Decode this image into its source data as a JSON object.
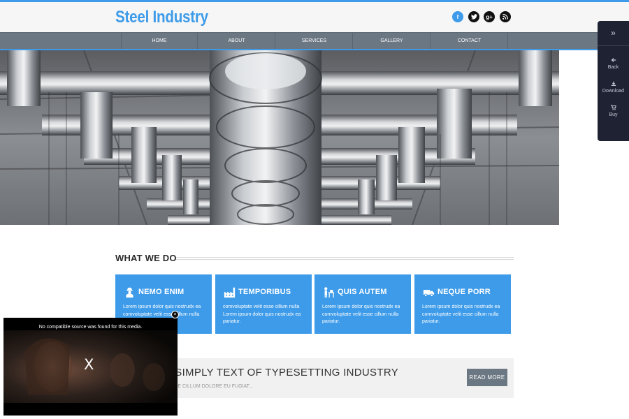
{
  "header": {
    "logo": "Steel Industry",
    "social": [
      {
        "icon": "facebook-icon",
        "glyph": "f",
        "color": "#3d9be9"
      },
      {
        "icon": "twitter-icon",
        "glyph": "",
        "color": "#111111"
      },
      {
        "icon": "google-plus-icon",
        "glyph": "g+",
        "color": "#111111"
      },
      {
        "icon": "rss-icon",
        "glyph": "",
        "color": "#111111"
      }
    ]
  },
  "nav": {
    "items": [
      "HOME",
      "ABOUT",
      "SERVICES",
      "GALLERY",
      "CONTACT"
    ]
  },
  "side_panel": {
    "expand_icon": "double-chevron-right-icon",
    "buttons": [
      {
        "icon": "arrow-left-icon",
        "label": "Back"
      },
      {
        "icon": "download-icon",
        "label": "Download"
      },
      {
        "icon": "cart-icon",
        "label": "Buy"
      }
    ]
  },
  "what_we_do": {
    "title": "WHAT WE DO",
    "cards": [
      {
        "icon": "worker-icon",
        "title": "NEMO ENIM",
        "text": "Lorem ipsum dolor quis nostrudx ea comvoluptate velit esse cillum nulla pariatur."
      },
      {
        "icon": "factory-icon",
        "title": "TEMPORIBUS",
        "text": "comvoluptate velit esse cillum nulla Lorem ipsum dolor quis nostrudx ea pariatur."
      },
      {
        "icon": "engineer-desk-icon",
        "title": "QUIS AUTEM",
        "text": "Lorem ipsum dolor quis nostrudx ea comvoluptate velit esse cillum nulla pariatur."
      },
      {
        "icon": "truck-icon",
        "title": "NEQUE PORR",
        "text": "Lorem ipsum dolor quis nostrudx ea comvoluptate velit esse cillum nulla pariatur."
      }
    ]
  },
  "promo": {
    "title": "UM IS SIMPLY TEXT OF TYPESETTING INDUSTRY",
    "subtitle": "SSE CILLUM DOLORE EU FUGIAT...",
    "button": "READ MORE"
  },
  "video": {
    "message": "No compatible source was found for this media.",
    "x_mark": "X",
    "close": "×"
  },
  "colors": {
    "accent": "#3d9be9",
    "nav_bg": "#6b7783",
    "side_panel_bg": "#1e2233"
  }
}
